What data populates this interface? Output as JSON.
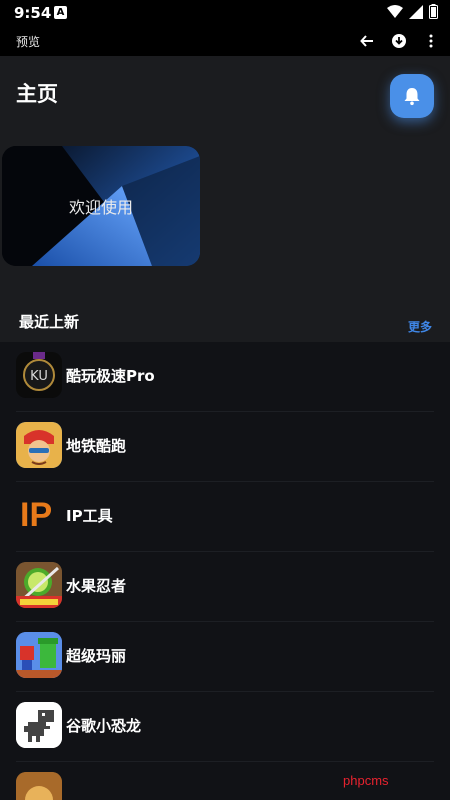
{
  "status_bar": {
    "time": "9:54",
    "notification_badge": "A"
  },
  "app_bar": {
    "title": "预览",
    "actions": [
      "back-arrow-icon",
      "download-icon",
      "more-vert-icon"
    ]
  },
  "page": {
    "title": "主页"
  },
  "banner": {
    "text": "欢迎使用"
  },
  "section": {
    "title": "最近上新",
    "more": "更多"
  },
  "apps": [
    {
      "name": "酷玩极速Pro",
      "icon": "ku-app-icon"
    },
    {
      "name": "地铁酷跑",
      "icon": "subway-runner-icon"
    },
    {
      "name": "IP工具",
      "icon": "ip-tool-icon",
      "icon_text": "IP"
    },
    {
      "name": "水果忍者",
      "icon": "fruit-ninja-icon"
    },
    {
      "name": "超级玛丽",
      "icon": "super-mario-icon"
    },
    {
      "name": "谷歌小恐龙",
      "icon": "dino-icon"
    }
  ],
  "watermark": "phpcms",
  "colors": {
    "accent": "#4a90e8",
    "link": "#3f86e6",
    "background": "#1b1c1f",
    "list_background": "#111216"
  }
}
